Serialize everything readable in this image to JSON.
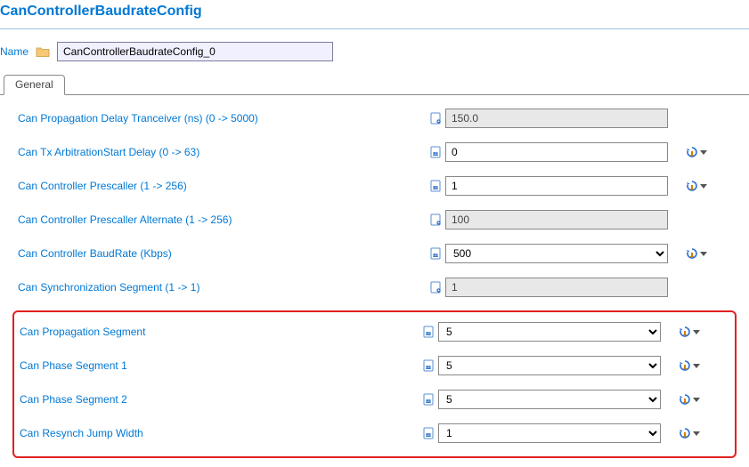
{
  "header": {
    "title": "CanControllerBaudrateConfig"
  },
  "nameRow": {
    "label": "Name",
    "value": "CanControllerBaudrateConfig_0"
  },
  "tabs": {
    "general": "General"
  },
  "fields": {
    "propDelay": {
      "label": "Can Propagation Delay Tranceiver (ns) (0 -> 5000)",
      "value": "150.0"
    },
    "txArb": {
      "label": "Can Tx ArbitrationStart Delay (0 -> 63)",
      "value": "0"
    },
    "prescaler": {
      "label": "Can Controller Prescaller (1 -> 256)",
      "value": "1"
    },
    "prescalerAlt": {
      "label": "Can Controller Prescaller Alternate (1 -> 256)",
      "value": "100"
    },
    "baud": {
      "label": "Can Controller BaudRate (Kbps)",
      "value": "500"
    },
    "syncSeg": {
      "label": "Can Synchronization Segment (1 -> 1)",
      "value": "1"
    },
    "propSeg": {
      "label": "Can Propagation Segment",
      "value": "5"
    },
    "phase1": {
      "label": "Can Phase Segment 1",
      "value": "5"
    },
    "phase2": {
      "label": "Can Phase Segment 2",
      "value": "5"
    },
    "resynch": {
      "label": "Can Resynch Jump Width",
      "value": "1"
    }
  }
}
